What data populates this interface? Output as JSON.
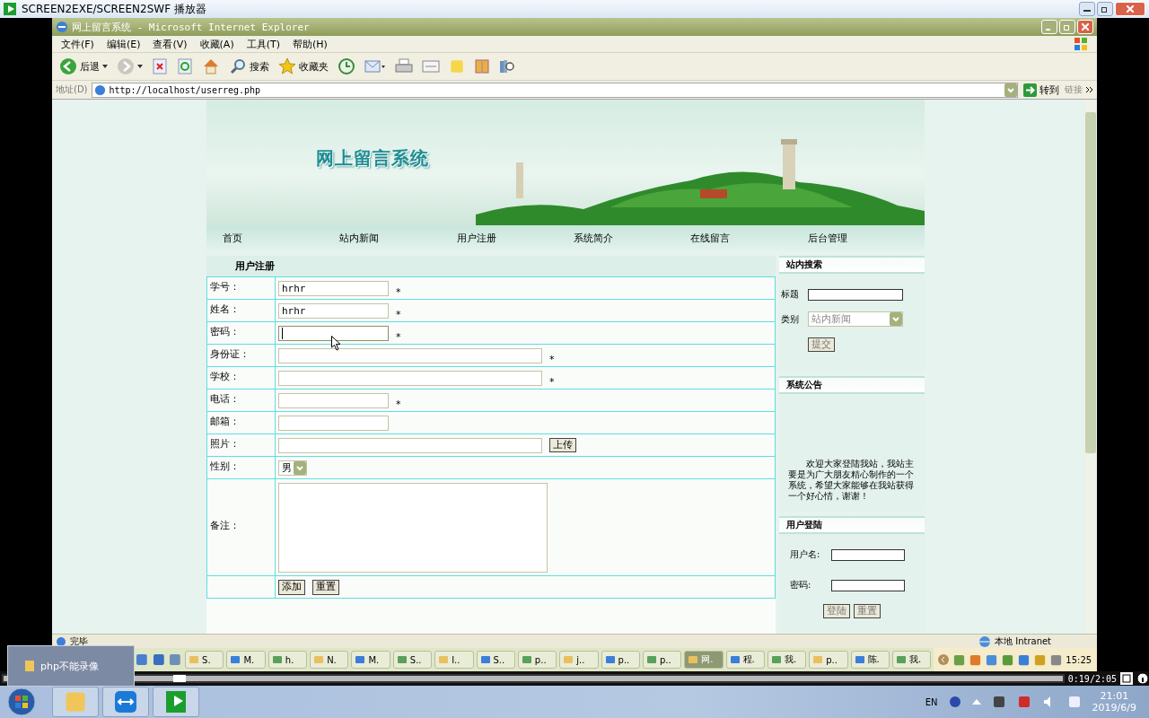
{
  "player": {
    "title": "SCREEN2EXE/SCREEN2SWF 播放器",
    "level": 0.16,
    "time": "0:19/2:05"
  },
  "browser": {
    "title": "网上留言系统 - Microsoft Internet Explorer",
    "menu": [
      "文件(F)",
      "编辑(E)",
      "查看(V)",
      "收藏(A)",
      "工具(T)",
      "帮助(H)"
    ],
    "toolbar": [
      {
        "kind": "back",
        "label": "后退"
      },
      {
        "kind": "forward"
      },
      {
        "kind": "stop"
      },
      {
        "kind": "refresh"
      },
      {
        "kind": "home"
      },
      {
        "kind": "search",
        "label": "搜索"
      },
      {
        "kind": "favorites",
        "label": "收藏夹"
      },
      {
        "kind": "history"
      },
      {
        "kind": "mail"
      },
      {
        "kind": "print"
      },
      {
        "kind": "edit"
      },
      {
        "kind": "note"
      },
      {
        "kind": "book"
      },
      {
        "kind": "research"
      }
    ],
    "address": {
      "label": "地址(D)",
      "url": "http://localhost/userreg.php",
      "go": "转到",
      "links": "链接"
    },
    "status": {
      "text": "完毕",
      "zone": "本地 Intranet"
    }
  },
  "site": {
    "title": "网上留言系统",
    "nav": [
      "首页",
      "站内新闻",
      "用户注册",
      "系统简介",
      "在线留言",
      "后台管理"
    ],
    "form": {
      "title": "用户注册",
      "rows": [
        {
          "kind": "short",
          "label": "学号：",
          "value": "hrhr",
          "required": "*",
          "focused": false
        },
        {
          "kind": "short",
          "label": "姓名：",
          "value": "hrhr",
          "required": "*",
          "focused": false
        },
        {
          "kind": "short",
          "label": "密码：",
          "value": "",
          "required": "*",
          "focused": true
        },
        {
          "kind": "long",
          "label": "身份证：",
          "value": "",
          "required": "*",
          "focused": false
        },
        {
          "kind": "long",
          "label": "学校：",
          "value": "",
          "required": "*",
          "focused": false
        },
        {
          "kind": "short",
          "label": "电话：",
          "value": "",
          "required": "*",
          "focused": false
        },
        {
          "kind": "short",
          "label": "邮箱：",
          "value": "",
          "focused": false
        },
        {
          "kind": "file",
          "label": "照片：",
          "value": "",
          "button": "上传",
          "focused": false
        },
        {
          "kind": "select",
          "label": "性别：",
          "value": "男",
          "focused": false
        },
        {
          "kind": "textarea",
          "label": "备注：",
          "value": "",
          "focused": false
        }
      ],
      "buttons": [
        "添加",
        "重置"
      ]
    },
    "search": {
      "title": "站内搜索",
      "title_label": "标题",
      "category_label": "类别",
      "category": "站内新闻",
      "button": "提交"
    },
    "notice": {
      "title": "系统公告",
      "text": "欢迎大家登陆我站，我站主要是为广大朋友精心制作的一个系统，希望大家能够在我站获得一个好心情，谢谢！"
    },
    "login": {
      "title": "用户登陆",
      "fields": [
        "用户名:",
        "密码:"
      ],
      "buttons": [
        "登陆",
        "重置"
      ]
    }
  },
  "xp_taskbar": {
    "tasks": [
      {
        "label": "S.",
        "selected": false
      },
      {
        "label": "M.",
        "selected": false
      },
      {
        "label": "h.",
        "selected": false
      },
      {
        "label": "N.",
        "selected": false
      },
      {
        "label": "M.",
        "selected": false
      },
      {
        "label": "S..",
        "selected": false
      },
      {
        "label": "I..",
        "selected": false
      },
      {
        "label": "S..",
        "selected": false
      },
      {
        "label": "p..",
        "selected": false
      },
      {
        "label": "j..",
        "selected": false
      },
      {
        "label": "p..",
        "selected": false
      },
      {
        "label": "p..",
        "selected": false
      },
      {
        "label": "网.",
        "selected": true
      },
      {
        "label": "程.",
        "selected": false
      },
      {
        "label": "我.",
        "selected": false
      },
      {
        "label": "p..",
        "selected": false
      },
      {
        "label": "陈.",
        "selected": false
      },
      {
        "label": "我.",
        "selected": false
      }
    ],
    "clock": "15:25"
  },
  "popup": {
    "label": "php不能录像"
  },
  "win7_taskbar": {
    "language": "EN",
    "time": "21:01",
    "date": "2019/6/9"
  }
}
